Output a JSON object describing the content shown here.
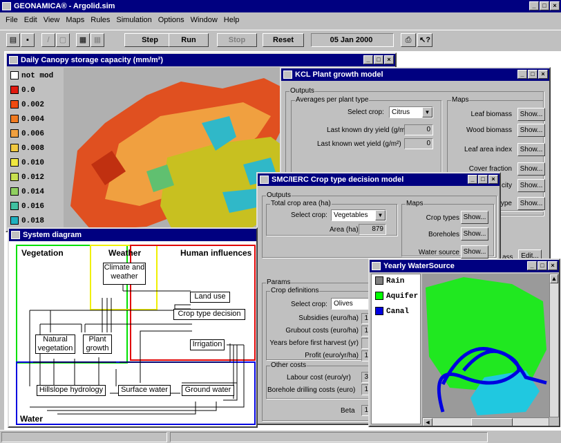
{
  "app": {
    "title": "GEONAMICA® - Argolid.sim",
    "menu": [
      "File",
      "Edit",
      "View",
      "Maps",
      "Rules",
      "Simulation",
      "Options",
      "Window",
      "Help"
    ],
    "toolbar": {
      "step": "Step",
      "run": "Run",
      "stop": "Stop",
      "reset": "Reset",
      "date": "05 Jan 2000"
    }
  },
  "canopy": {
    "title": "Daily Canopy storage capacity (mm/m²)",
    "legend": [
      {
        "label": "not mod",
        "color": "#ffffff"
      },
      {
        "label": "0.0",
        "color": "#e01a10"
      },
      {
        "label": "0.002",
        "color": "#f04a10"
      },
      {
        "label": "0.004",
        "color": "#f07a20"
      },
      {
        "label": "0.006",
        "color": "#f0a040"
      },
      {
        "label": "0.008",
        "color": "#f0c840"
      },
      {
        "label": "0.010",
        "color": "#f0e840"
      },
      {
        "label": "0.012",
        "color": "#c8e050"
      },
      {
        "label": "0.014",
        "color": "#90d060"
      },
      {
        "label": "0.016",
        "color": "#40c0a0"
      },
      {
        "label": "0.018",
        "color": "#20b0c0"
      }
    ]
  },
  "kcl": {
    "title": "KCL Plant growth model",
    "outputs": "Outputs",
    "averages": "Averages per plant type",
    "select_crop_label": "Select crop:",
    "crop": "Citrus",
    "dry_label": "Last known dry yield (g/m²)",
    "dry_val": "0",
    "wet_label": "Last known wet yield (g/m²)",
    "wet_val": "0",
    "maps": "Maps",
    "map_items": [
      "Leaf biomass",
      "Wood biomass",
      "Leaf area index",
      "Cover fraction",
      "city",
      "ype"
    ],
    "show": "Show...",
    "edit": "Edit...",
    "partial": "ass"
  },
  "smc": {
    "title": "SMC/IERC Crop type decision model",
    "outputs": "Outputs",
    "total": "Total crop area (ha)",
    "select_crop_label": "Select crop:",
    "crop": "Vegetables",
    "area_label": "Area (ha)",
    "area_val": "879",
    "maps": "Maps",
    "map_items": [
      "Crop types",
      "Boreholes",
      "Water source"
    ],
    "show": "Show...",
    "params": "Params",
    "crop_defs": "Crop definitions",
    "crop2": "Olives",
    "param_labels": [
      "Subsidies (euro/ha)",
      "Grubout costs (euro/ha)",
      "Years before first harvest (yr)",
      "Profit (euro/yr/ha)"
    ],
    "param_vals": [
      "1",
      "1",
      "",
      "1"
    ],
    "other": "Other costs",
    "labour": "Labour cost (euro/yr)",
    "labour_val": "3",
    "borehole": "Borehole drilling costs (euro)",
    "borehole_val": "1",
    "beta": "Beta",
    "beta_val": "1"
  },
  "system": {
    "title": "System diagram",
    "vegetation": "Vegetation",
    "weather": "Weather",
    "human": "Human influences",
    "water": "Water",
    "nodes": {
      "climate": "Climate and weather",
      "landuse": "Land use",
      "croptype": "Crop type decision",
      "irrigation": "Irrigation",
      "natveg": "Natural vegetation",
      "plant": "Plant growth",
      "hillslope": "Hillslope hydrology",
      "surface": "Surface water",
      "ground": "Ground water"
    }
  },
  "yearly": {
    "title": "Yearly WaterSource",
    "legend": [
      {
        "label": "Rain",
        "color": "#808080"
      },
      {
        "label": "Aquifer",
        "color": "#00ff00"
      },
      {
        "label": "Canal",
        "color": "#0000e0"
      }
    ]
  }
}
